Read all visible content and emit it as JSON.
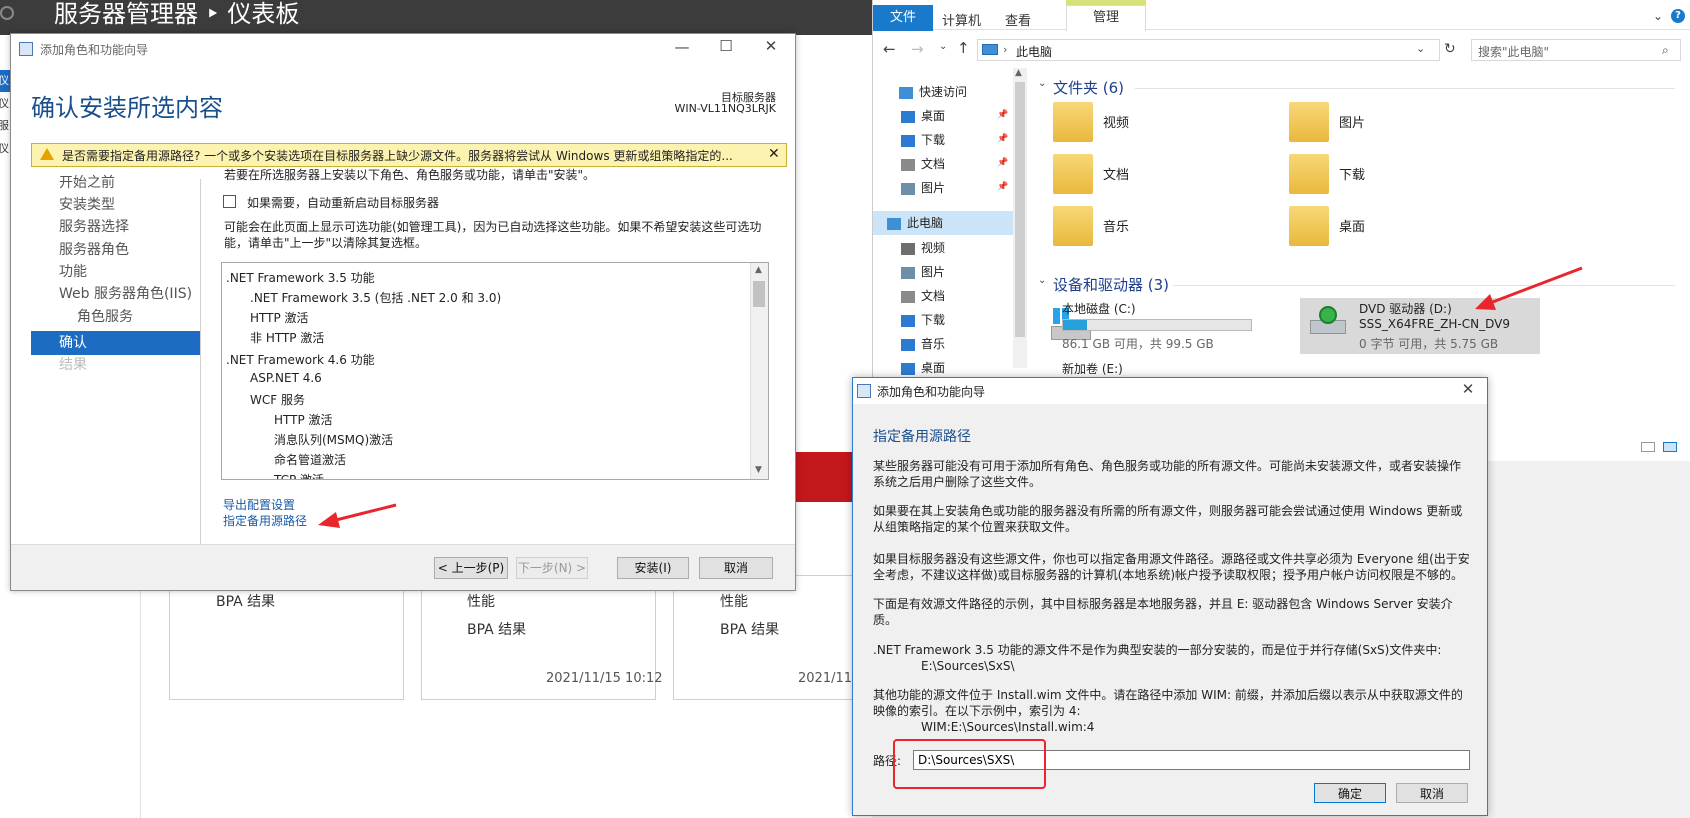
{
  "server_manager": {
    "title": "服务器管理器 ‣ 仪表板",
    "tiles": [
      {
        "rows": [
          "BPA 结果"
        ],
        "date": ""
      },
      {
        "rows": [
          "性能",
          "BPA 结果"
        ],
        "date": "2021/11/15 10:12"
      },
      {
        "rows": [
          "性能",
          "BPA 结果"
        ],
        "date": "2021/11/"
      }
    ],
    "left_letters": [
      "仪",
      "仪",
      "服",
      "仪"
    ],
    "accent_red": "#c4171c"
  },
  "wizard": {
    "window_title": "添加角色和功能向导",
    "heading": "确认安装所选内容",
    "target_label": "目标服务器",
    "target_value": "WIN-VL11NQ3LRJK",
    "warning": "是否需要指定备用源路径? 一个或多个安装选项在目标服务器上缺少源文件。服务器将尝试从 Windows 更新或组策略指定的...",
    "nav": [
      "开始之前",
      "安装类型",
      "服务器选择",
      "服务器角色",
      "功能",
      "Web 服务器角色(IIS)",
      "角色服务",
      "确认",
      "结果"
    ],
    "intro": "若要在所选服务器上安装以下角色、角色服务或功能，请单击\"安装\"。",
    "restart_checkbox": "如果需要，自动重新启动目标服务器",
    "note_line1": "可能会在此页面上显示可选功能(如管理工具)，因为已自动选择这些功能。如果不希望安装这些可选功",
    "note_line2": "能，请单击\"上一步\"以清除其复选框。",
    "features": [
      ".NET Framework 3.5 功能",
      ".NET Framework 3.5 (包括 .NET 2.0 和 3.0)",
      "HTTP 激活",
      "非 HTTP 激活",
      ".NET Framework 4.6 功能",
      "ASP.NET 4.6",
      "WCF 服务",
      "HTTP 激活",
      "消息队列(MSMQ)激活",
      "命名管道激活",
      "TCP 激活"
    ],
    "link_export": "导出配置设置",
    "link_alt_source": "指定备用源路径",
    "btn_prev": "< 上一步(P)",
    "btn_next": "下一步(N) >",
    "btn_install": "安装(I)",
    "btn_cancel": "取消"
  },
  "explorer": {
    "tabs": [
      "文件",
      "计算机",
      "查看",
      "管理"
    ],
    "address": "此电脑",
    "search_placeholder": "搜索\"此电脑\"",
    "nav": [
      {
        "label": "快速访问",
        "icon": "star-icon",
        "pinned": false
      },
      {
        "label": "桌面",
        "icon": "desktop-icon",
        "pinned": true
      },
      {
        "label": "下载",
        "icon": "download-icon",
        "pinned": true
      },
      {
        "label": "文档",
        "icon": "document-icon",
        "pinned": true
      },
      {
        "label": "图片",
        "icon": "picture-icon",
        "pinned": true
      },
      {
        "label": "此电脑",
        "icon": "computer-icon",
        "pinned": false
      },
      {
        "label": "视频",
        "icon": "video-icon",
        "pinned": false
      },
      {
        "label": "图片",
        "icon": "picture-icon",
        "pinned": false
      },
      {
        "label": "文档",
        "icon": "document-icon",
        "pinned": false
      },
      {
        "label": "下载",
        "icon": "download-icon",
        "pinned": false
      },
      {
        "label": "音乐",
        "icon": "music-icon",
        "pinned": false
      },
      {
        "label": "桌面",
        "icon": "desktop-icon",
        "pinned": false
      }
    ],
    "folders_header": "文件夹 (6)",
    "folders": [
      "视频",
      "图片",
      "文档",
      "下载",
      "音乐",
      "桌面"
    ],
    "drives_header": "设备和驱动器 (3)",
    "drive_c": {
      "name": "本地磁盘 (C:)",
      "free": "86.1 GB 可用，共 99.5 GB",
      "used_fraction": 0.13
    },
    "drive_d": {
      "name": "DVD 驱动器 (D:)",
      "label": "SSS_X64FRE_ZH-CN_DV9",
      "free": "0 字节 可用，共 5.75 GB"
    },
    "drive_e": {
      "name": "新加卷 (E:)"
    }
  },
  "dialog": {
    "window_title": "添加角色和功能向导",
    "heading": "指定备用源路径",
    "p1": [
      "某些服务器可能没有可用于添加所有角色、角色服务或功能的所有源文件。可能尚未安装源文件，或者安装操作",
      "系统之后用户删除了这些文件。"
    ],
    "p2": [
      "如果要在其上安装角色或功能的服务器没有所需的所有源文件，则服务器可能会尝试通过使用 Windows 更新或",
      "从组策略指定的某个位置来获取文件。"
    ],
    "p3": [
      "如果目标服务器没有这些源文件，你也可以指定备用源文件路径。源路径或文件共享必须为 Everyone 组(出于安",
      "全考虑，不建议这样做)或目标服务器的计算机(本地系统)帐户授予读取权限；授予用户帐户访问权限是不够的。"
    ],
    "p4": [
      "下面是有效源文件路径的示例，其中目标服务器是本地服务器，并且 E: 驱动器包含 Windows Server 安装介",
      "质。"
    ],
    "p5": ".NET Framework 3.5 功能的源文件不是作为典型安装的一部分安装的，而是位于并行存储(SxS)文件夹中:",
    "p5_example": "E:\\Sources\\SxS\\",
    "p6": [
      "其他功能的源文件位于 Install.wim 文件中。请在路径中添加 WIM: 前缀，并添加后缀以表示从中获取源文件的",
      "映像的索引。在以下示例中，索引为 4:"
    ],
    "p6_example": "WIM:E:\\Sources\\Install.wim:4",
    "path_label": "路径:",
    "path_value": "D:\\Sources\\SXS\\",
    "btn_ok": "确定",
    "btn_cancel": "取消"
  },
  "annotation_color": "#e8262b"
}
